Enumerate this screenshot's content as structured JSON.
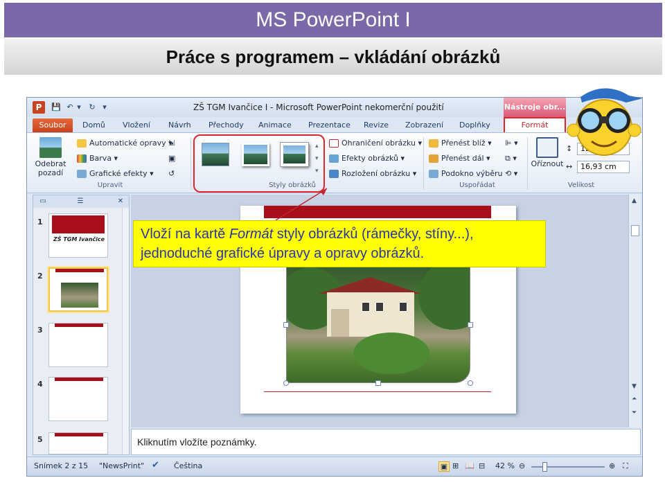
{
  "slide": {
    "title": "MS PowerPoint I",
    "subtitle": "Práce s programem – vkládání obrázků"
  },
  "window": {
    "title": "ZŠ TGM Ivančice I  -  Microsoft PowerPoint nekomerční použití",
    "context_tools": "Nástroje obr...",
    "app_logo": "P"
  },
  "tabs": [
    "Soubor",
    "Domů",
    "Vložení",
    "Návrh",
    "Přechody",
    "Animace",
    "Prezentace",
    "Revize",
    "Zobrazení",
    "Doplňky",
    "Formát"
  ],
  "ribbon": {
    "upravit": {
      "label": "Upravit",
      "remove_bg": "Odebrat pozadí",
      "auto_fix": "Automatické opravy",
      "color": "Barva",
      "effects": "Grafické efekty"
    },
    "styles": {
      "label": "Styly obrázků",
      "border": "Ohraničení obrázku",
      "effects": "Efekty obrázků",
      "layout": "Rozložení obrázku"
    },
    "arrange": {
      "label": "Uspořádat",
      "forward": "Přenést blíž",
      "backward": "Přenést dál",
      "pane": "Podokno výběru"
    },
    "size": {
      "label": "Velikost",
      "crop": "Oříznout",
      "height": "12,7 cm",
      "width": "16,93 cm"
    }
  },
  "slides_pane": {
    "numbers": [
      "1",
      "2",
      "3",
      "4",
      "5"
    ],
    "slide1_title": "ZŠ TGM Ivančice"
  },
  "callout": {
    "line1_before": "Vloží na kartě ",
    "line1_em": "Formát",
    "line1_after": " styly obrázků (rámečky, stíny...),",
    "line2": "jednoduché grafické úpravy a opravy obrázků."
  },
  "notes": "Kliknutím vložíte poznámky.",
  "status": {
    "slide": "Snímek 2 z 15",
    "theme": "\"NewsPrint\"",
    "language": "Čeština",
    "zoom": "42 %"
  },
  "colors": {
    "title_bar": "#7a68a8",
    "accent_red": "#e0262d",
    "callout_bg": "#ffff00",
    "callout_text": "#2a36a8"
  }
}
